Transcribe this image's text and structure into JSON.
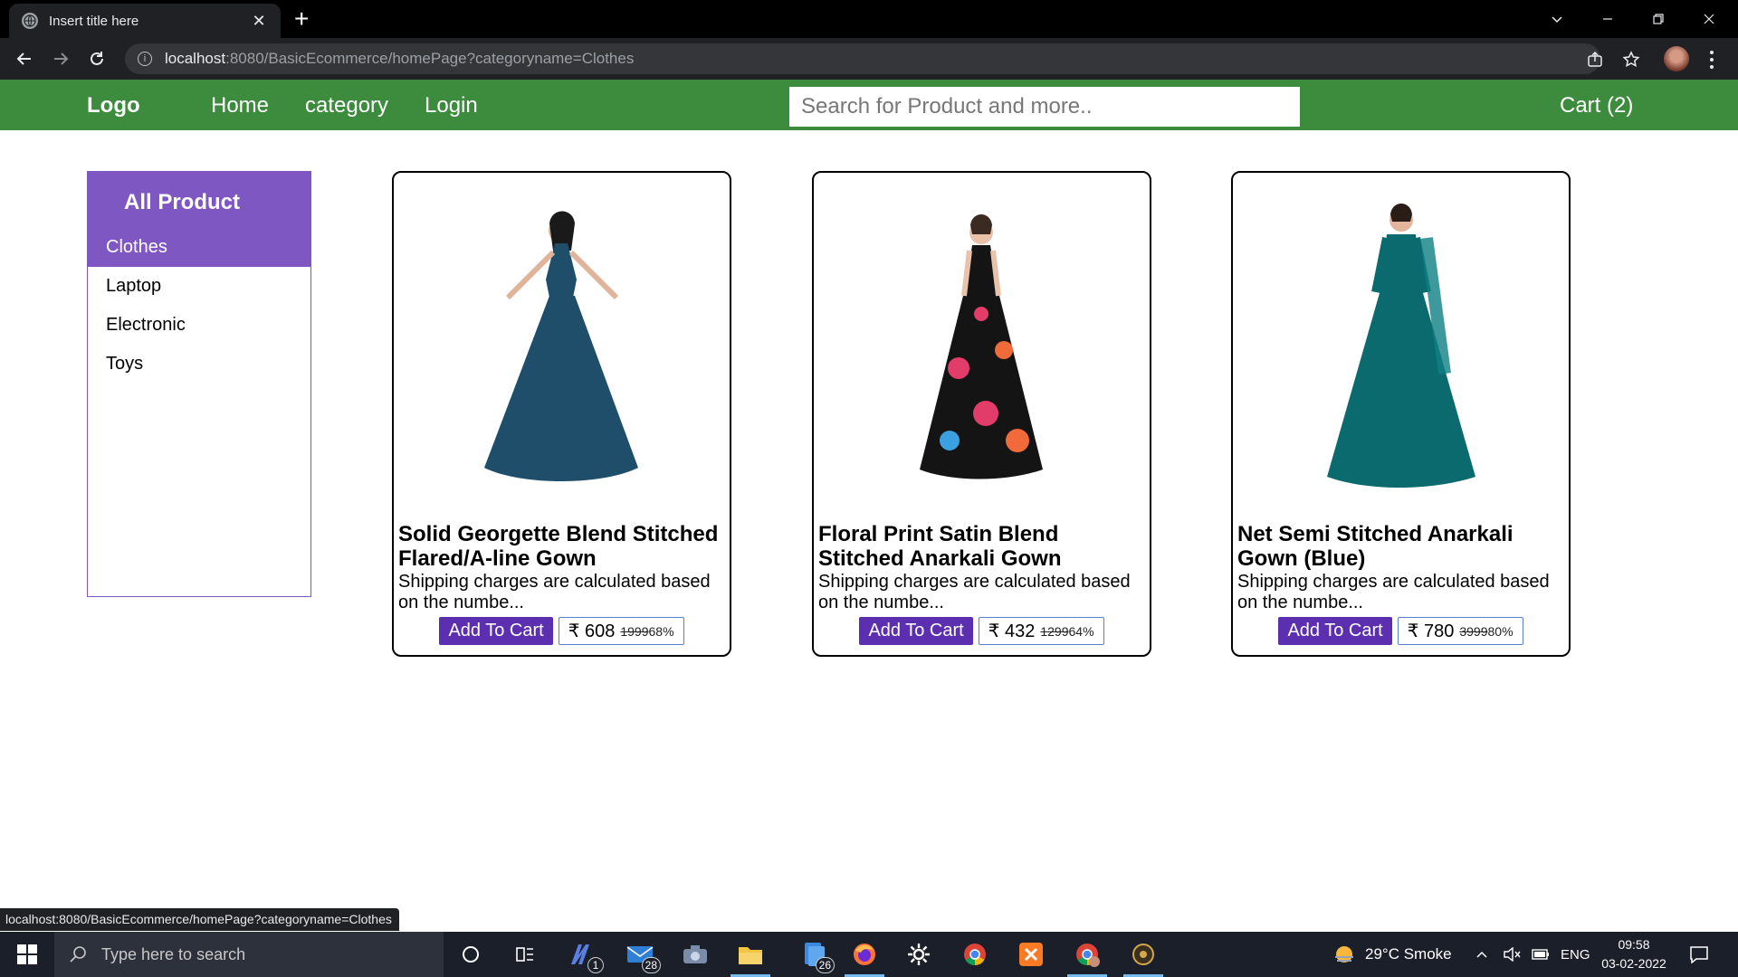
{
  "browser": {
    "tab_title": "Insert title here",
    "tab_close": "✕",
    "new_tab": "+",
    "url_host": "localhost",
    "url_path": ":8080/BasicEcommerce/homePage?categoryname=Clothes",
    "status_url": "localhost:8080/BasicEcommerce/homePage?categoryname=Clothes"
  },
  "header": {
    "logo": "Logo",
    "nav": [
      "Home",
      "category",
      "Login"
    ],
    "search_placeholder": "Search for Product and more..",
    "cart": "Cart (2)"
  },
  "sidebar": {
    "heading": "All Product",
    "categories": [
      "Clothes",
      "Laptop",
      "Electronic",
      "Toys"
    ],
    "active": "Clothes"
  },
  "products": [
    {
      "title": "Solid Georgette Blend Stitched Flared/A-line Gown",
      "desc": "Shipping charges are calculated based on the numbe...",
      "button": "Add To Cart",
      "price": "₹ 608",
      "old_price": "1999",
      "discount": "68%",
      "dress_color": "#1f4e6b"
    },
    {
      "title": "Floral Print Satin Blend Stitched Anarkali Gown",
      "desc": "Shipping charges are calculated based on the numbe...",
      "button": "Add To Cart",
      "price": "₹ 432",
      "old_price": "1299",
      "discount": "64%",
      "dress_color": "#141414"
    },
    {
      "title": "Net Semi Stitched Anarkali Gown (Blue)",
      "desc": "Shipping charges are calculated based on the numbe...",
      "button": "Add To Cart",
      "price": "₹ 780",
      "old_price": "3999",
      "discount": "80%",
      "dress_color": "#0b6a6e"
    }
  ],
  "taskbar": {
    "search_placeholder": "Type here to search",
    "badges": {
      "mail_app": "1",
      "mail": "28",
      "files": "26"
    },
    "weather": "29°C  Smoke",
    "lang": "ENG",
    "time": "09:58",
    "date": "03-02-2022"
  },
  "colors": {
    "header_green": "#3d8b3d",
    "sidebar_purple": "#7e57c2",
    "button_purple": "#5b2fb0"
  }
}
